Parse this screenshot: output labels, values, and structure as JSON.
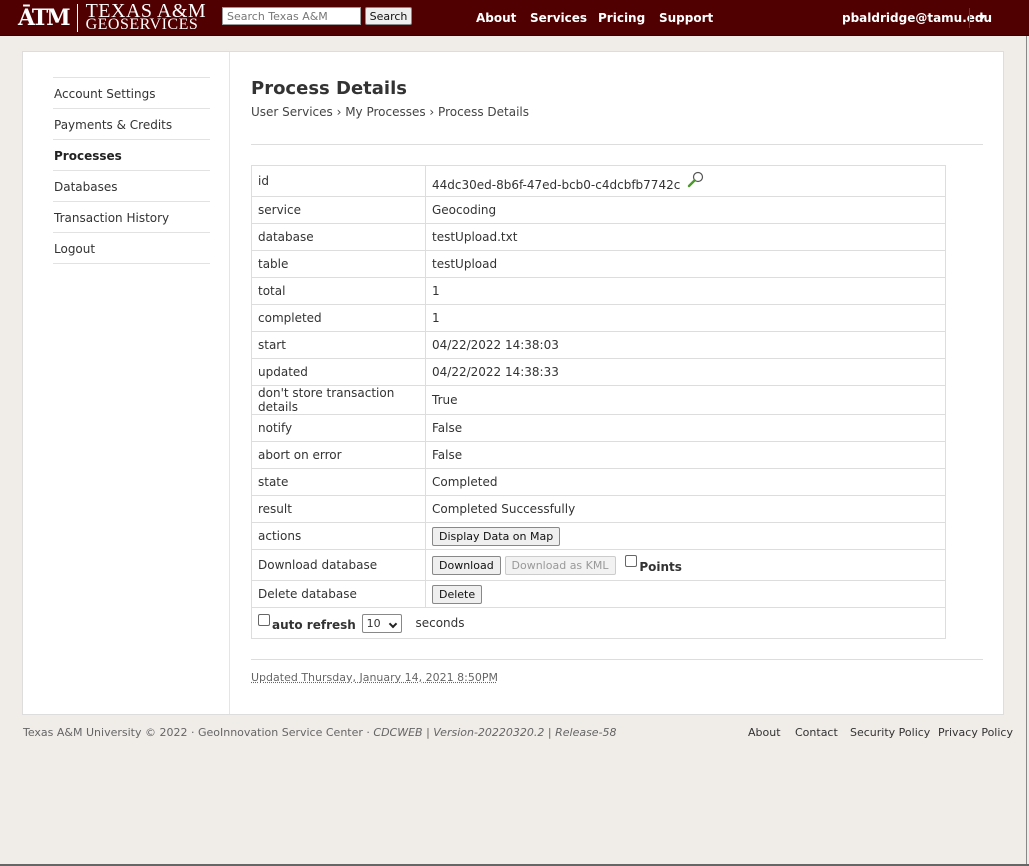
{
  "header": {
    "logo_mark": "ĀTM",
    "logo_line1": "TEXAS A&M",
    "logo_line2": "GEOSERVICES",
    "search_placeholder": "Search Texas A&M",
    "search_button": "Search",
    "nav": [
      "About",
      "Services",
      "Pricing",
      "Support"
    ],
    "user_email": "pbaldridge@tamu.edu"
  },
  "sidebar": {
    "items": [
      {
        "label": "Account Settings",
        "active": false
      },
      {
        "label": "Payments & Credits",
        "active": false
      },
      {
        "label": "Processes",
        "active": true
      },
      {
        "label": "Databases",
        "active": false
      },
      {
        "label": "Transaction History",
        "active": false
      },
      {
        "label": "Logout",
        "active": false
      }
    ]
  },
  "main": {
    "title": "Process Details",
    "breadcrumb": "User Services › My Processes › Process Details",
    "rows": {
      "id": {
        "key": "id",
        "value": "44dc30ed-8b6f-47ed-bcb0-c4dcbfb7742c"
      },
      "service": {
        "key": "service",
        "value": "Geocoding"
      },
      "database": {
        "key": "database",
        "value": "testUpload.txt"
      },
      "table": {
        "key": "table",
        "value": "testUpload"
      },
      "total": {
        "key": "total",
        "value": "1"
      },
      "completed": {
        "key": "completed",
        "value": "1"
      },
      "start": {
        "key": "start",
        "value": "04/22/2022 14:38:03"
      },
      "updated": {
        "key": "updated",
        "value": "04/22/2022 14:38:33"
      },
      "dont_store": {
        "key": "don't store transaction details",
        "value": "True"
      },
      "notify": {
        "key": "notify",
        "value": "False"
      },
      "abort": {
        "key": "abort on error",
        "value": "False"
      },
      "state": {
        "key": "state",
        "value": "Completed"
      },
      "result": {
        "key": "result",
        "value": "Completed Successfully"
      },
      "actions": {
        "key": "actions",
        "button": "Display Data on Map"
      },
      "download": {
        "key": "Download database",
        "button": "Download",
        "kml_button": "Download as KML",
        "points_label": "Points"
      },
      "delete": {
        "key": "Delete database",
        "button": "Delete"
      }
    },
    "auto_refresh_label": "auto refresh",
    "refresh_value": "10",
    "seconds_label": "seconds",
    "updated_note": "Updated Thursday, January 14, 2021 8:50PM"
  },
  "footer": {
    "copyright": "Texas A&M University © 2022 · GeoInnovation Service Center ·",
    "version": "CDCWEB | Version-20220320.2 | Release-58",
    "links": [
      "About",
      "Contact",
      "Security Policy",
      "Privacy Policy"
    ]
  }
}
